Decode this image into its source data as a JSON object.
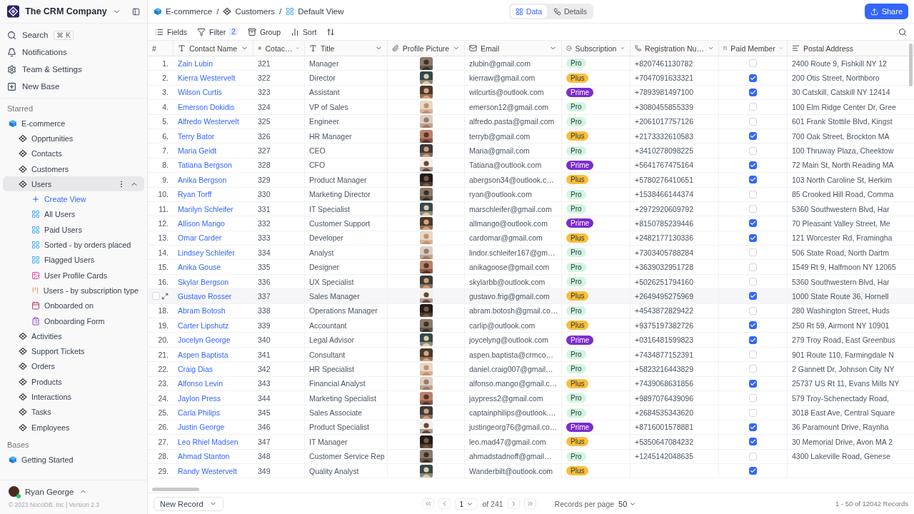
{
  "sidebar": {
    "workspace": "The CRM Company",
    "actions": [
      {
        "label": "Search",
        "kind": "search",
        "shortcut": "⌘ K"
      },
      {
        "label": "Notifications",
        "kind": "bell"
      },
      {
        "label": "Team & Settings",
        "kind": "gear"
      },
      {
        "label": "New Base",
        "kind": "new"
      }
    ],
    "sections": [
      {
        "title": "Starred",
        "bases": [
          {
            "name": "E-commerce",
            "tables": [
              {
                "name": "Opprtunities",
                "selected": false,
                "expanded": false
              },
              {
                "name": "Contacts",
                "selected": false,
                "expanded": false
              },
              {
                "name": "Customers",
                "selected": false,
                "expanded": false
              },
              {
                "name": "Users",
                "selected": true,
                "expanded": true,
                "views": [
                  {
                    "label": "Create View",
                    "kind": "create"
                  },
                  {
                    "label": "All Users",
                    "kind": "grid"
                  },
                  {
                    "label": "Paid Users",
                    "kind": "grid"
                  },
                  {
                    "label": "Sorted - by orders placed",
                    "kind": "grid"
                  },
                  {
                    "label": "Flagged Users",
                    "kind": "grid"
                  },
                  {
                    "label": "User Profile Cards",
                    "kind": "gallery"
                  },
                  {
                    "label": "Users - by subscription type",
                    "kind": "kanban"
                  },
                  {
                    "label": "Onboarded on",
                    "kind": "calendar"
                  },
                  {
                    "label": "Onboarding Form",
                    "kind": "form"
                  }
                ]
              },
              {
                "name": "Activities",
                "selected": false,
                "expanded": false
              },
              {
                "name": "Support Tickets",
                "selected": false,
                "expanded": false
              },
              {
                "name": "Orders",
                "selected": false,
                "expanded": false
              },
              {
                "name": "Products",
                "selected": false,
                "expanded": false
              },
              {
                "name": "Interactions",
                "selected": false,
                "expanded": false
              },
              {
                "name": "Tasks",
                "selected": false,
                "expanded": false
              },
              {
                "name": "Employees",
                "selected": false,
                "expanded": false
              }
            ]
          }
        ]
      },
      {
        "title": "Bases",
        "bases": [
          {
            "name": "Getting Started"
          }
        ]
      }
    ],
    "user": {
      "name": "Ryan George",
      "online": true
    },
    "copyright": "© 2023 NocoDB. Inc | Version 2.3"
  },
  "topbar": {
    "separator": "/",
    "breadcrumb": [
      {
        "label": "E-commerce",
        "kind": "base"
      },
      {
        "label": "Customers",
        "kind": "table"
      },
      {
        "label": "Default View",
        "kind": "grid"
      }
    ],
    "tabs": [
      {
        "label": "Data",
        "kind": "data",
        "selected": true
      },
      {
        "label": "Details",
        "kind": "details",
        "selected": false
      }
    ],
    "share": "Share"
  },
  "toolbar": {
    "items": [
      {
        "label": "Fields",
        "kind": "fields"
      },
      {
        "label": "Filter",
        "kind": "filter",
        "count": "2"
      },
      {
        "label": "Group",
        "kind": "group"
      },
      {
        "label": "Sort",
        "kind": "sort"
      },
      {
        "kind": "row-height"
      }
    ]
  },
  "table": {
    "columns": [
      {
        "label": "#",
        "kind": "index"
      },
      {
        "label": "Contact Name",
        "kind": "text"
      },
      {
        "label": "Cotac…",
        "kind": "number"
      },
      {
        "label": "Title",
        "kind": "text"
      },
      {
        "label": "Profile Picture",
        "kind": "attachment"
      },
      {
        "label": "Email",
        "kind": "email"
      },
      {
        "label": "Subscription",
        "kind": "select"
      },
      {
        "label": "Registration Nu…",
        "kind": "phone"
      },
      {
        "label": "Paid Member",
        "kind": "checkbox"
      },
      {
        "label": "Postal Address",
        "kind": "address"
      }
    ],
    "rows": [
      {
        "n": "1.",
        "name": "Zain Lubin",
        "id": "321",
        "title": "Manager",
        "email": "zlubin@gmail.com",
        "sub": {
          "label": "Pro",
          "color": "#d2f4e3"
        },
        "phone": "+8207461130782",
        "paid": false,
        "address": "2400 Route 9, Fishkill NY 12",
        "hovered": false
      },
      {
        "n": "2.",
        "name": "Kierra Westervelt",
        "id": "322",
        "title": "Director",
        "email": "kierraw@gmail.com",
        "sub": {
          "label": "Plus",
          "color": "#fbbd3c"
        },
        "phone": "+7047091633321",
        "paid": true,
        "address": "200 Otis Street, Northboro",
        "hovered": false
      },
      {
        "n": "3.",
        "name": "Wilson Curtis",
        "id": "323",
        "title": "Assistant",
        "email": "wilcurtis@outlook.com",
        "sub": {
          "label": "Prime",
          "color": "#7b2bd1"
        },
        "phone": "+7893981497100",
        "paid": true,
        "address": "30 Catskill, Catskill NY 12414",
        "hovered": false
      },
      {
        "n": "4.",
        "name": "Emerson Dokidis",
        "id": "324",
        "title": "VP of Sales",
        "email": "emerson12@gmail.com",
        "sub": {
          "label": "Pro",
          "color": "#d2f4e3"
        },
        "phone": "+3080455855339",
        "paid": false,
        "address": "100 Elm Ridge Center Dr, Gree",
        "hovered": false
      },
      {
        "n": "5.",
        "name": "Alfredo Westervelt",
        "id": "325",
        "title": "Engineer",
        "email": "alfredo.pasta@gmail.com",
        "sub": {
          "label": "Pro",
          "color": "#d2f4e3"
        },
        "phone": "+2061017757126",
        "paid": false,
        "address": "601 Frank Stottile Blvd, Kingst",
        "hovered": false
      },
      {
        "n": "6.",
        "name": "Terry Bator",
        "id": "326",
        "title": "HR Manager",
        "email": "terryb@gmail.com",
        "sub": {
          "label": "Plus",
          "color": "#fbbd3c"
        },
        "phone": "+2173332610583",
        "paid": true,
        "address": "700 Oak Street, Brockton MA",
        "hovered": false
      },
      {
        "n": "7.",
        "name": "Maria Geidt",
        "id": "327",
        "title": "CEO",
        "email": "Maria@gmail.com",
        "sub": {
          "label": "Pro",
          "color": "#d2f4e3"
        },
        "phone": "+3410278098225",
        "paid": false,
        "address": "100 Thruway Plaza, Cheektow",
        "hovered": false
      },
      {
        "n": "8.",
        "name": "Tatiana Bergson",
        "id": "328",
        "title": "CFO",
        "email": "Tatiana@outlook.com",
        "sub": {
          "label": "Prime",
          "color": "#7b2bd1"
        },
        "phone": "+5641767475164",
        "paid": true,
        "address": "72 Main St, North Reading MA",
        "hovered": false
      },
      {
        "n": "9.",
        "name": "Anika Bergson",
        "id": "329",
        "title": "Product Manager",
        "email": "abergson34@outlook.c…",
        "sub": {
          "label": "Plus",
          "color": "#fbbd3c"
        },
        "phone": "+5780276410651",
        "paid": true,
        "address": "103 North Caroline St, Herkim",
        "hovered": false
      },
      {
        "n": "10.",
        "name": "Ryan Torff",
        "id": "330",
        "title": "Marketing Director",
        "email": "ryan@outlook.com",
        "sub": {
          "label": "Pro",
          "color": "#d2f4e3"
        },
        "phone": "+1538466144374",
        "paid": false,
        "address": "85 Crooked Hill Road, Comma",
        "hovered": false
      },
      {
        "n": "11.",
        "name": "Marilyn Schleifer",
        "id": "331",
        "title": "IT Specialist",
        "email": "marschleifer@gmail.com",
        "sub": {
          "label": "Pro",
          "color": "#d2f4e3"
        },
        "phone": "+2972920609792",
        "paid": false,
        "address": "5360 Southwestern Blvd, Har",
        "hovered": false
      },
      {
        "n": "12.",
        "name": "Allison Mango",
        "id": "332",
        "title": "Customer Support",
        "email": "allmango@outlook.com",
        "sub": {
          "label": "Prime",
          "color": "#7b2bd1"
        },
        "phone": "+8150785239446",
        "paid": true,
        "address": "70 Pleasant Valley Street, Me",
        "hovered": false
      },
      {
        "n": "13.",
        "name": "Omar Carder",
        "id": "333",
        "title": "Developer",
        "email": "cardomar@gmail.com",
        "sub": {
          "label": "Plus",
          "color": "#fbbd3c"
        },
        "phone": "+2482177130336",
        "paid": true,
        "address": "121 Worcester Rd, Framingha",
        "hovered": false
      },
      {
        "n": "14.",
        "name": "Lindsey Schleifer",
        "id": "334",
        "title": "Analyst",
        "email": "lindor.schleifer167@gm…",
        "sub": {
          "label": "Pro",
          "color": "#d2f4e3"
        },
        "phone": "+7303405788284",
        "paid": false,
        "address": "506 State Road, North Dartm",
        "hovered": false
      },
      {
        "n": "15.",
        "name": "Anika Gouse",
        "id": "335",
        "title": "Designer",
        "email": "anikagoose@gmail.com",
        "sub": {
          "label": "Pro",
          "color": "#d2f4e3"
        },
        "phone": "+3639032951728",
        "paid": false,
        "address": "1549 Rt 9, Halfmoon NY 12065",
        "hovered": false
      },
      {
        "n": "16.",
        "name": "Skylar Bergson",
        "id": "336",
        "title": "UX Specialist",
        "email": "skylarbb@outlook.com",
        "sub": {
          "label": "Pro",
          "color": "#d2f4e3"
        },
        "phone": "+5026251794160",
        "paid": false,
        "address": "5360 Southwestern Blvd, Har",
        "hovered": false
      },
      {
        "name": "Gustavo Rosser",
        "id": "337",
        "title": "Sales Manager",
        "email": "gustavo.frig@gmail.com",
        "sub": {
          "label": "Plus",
          "color": "#fbbd3c"
        },
        "phone": "+2649495275969",
        "paid": true,
        "address": "1000 State Route 36, Hornell",
        "hovered": true
      },
      {
        "n": "18.",
        "name": "Abram Botosh",
        "id": "338",
        "title": "Operations Manager",
        "email": "abram.botosh@gmail.co…",
        "sub": {
          "label": "Pro",
          "color": "#d2f4e3"
        },
        "phone": "+4543872829422",
        "paid": false,
        "address": "280 Washington Street, Huds",
        "hovered": false
      },
      {
        "n": "19.",
        "name": "Carter Lipshutz",
        "id": "339",
        "title": "Accountant",
        "email": "carlip@outlook.com",
        "sub": {
          "label": "Plus",
          "color": "#fbbd3c"
        },
        "phone": "+9375197382726",
        "paid": true,
        "address": "250 Rt 59, Airmont NY 10901",
        "hovered": false
      },
      {
        "n": "20.",
        "name": "Jocelyn George",
        "id": "340",
        "title": "Legal Advisor",
        "email": "joycelyng@outlook.com",
        "sub": {
          "label": "Prime",
          "color": "#7b2bd1"
        },
        "phone": "+0316481599823",
        "paid": true,
        "address": "279 Troy Road, East Greenbus",
        "hovered": false
      },
      {
        "n": "21.",
        "name": "Aspen Baptista",
        "id": "341",
        "title": "Consultant",
        "email": "aspen.baptista@crmco…",
        "sub": {
          "label": "Pro",
          "color": "#d2f4e3"
        },
        "phone": "+7434877152391",
        "paid": false,
        "address": "901 Route 110, Farmingdale N",
        "hovered": false
      },
      {
        "n": "22.",
        "name": "Craig Dias",
        "id": "342",
        "title": "HR Specialist",
        "email": "daniel.craig007@gmail…",
        "sub": {
          "label": "Pro",
          "color": "#d2f4e3"
        },
        "phone": "+5823216443829",
        "paid": false,
        "address": "2 Gannett Dr, Johnson City NY",
        "hovered": false
      },
      {
        "n": "23.",
        "name": "Alfonso Levin",
        "id": "343",
        "title": "Financial Analyst",
        "email": "alfonso.mango@gmail.c…",
        "sub": {
          "label": "Plus",
          "color": "#fbbd3c"
        },
        "phone": "+7439068631856",
        "paid": true,
        "address": "25737 US Rt 11, Evans Mills NY",
        "hovered": false
      },
      {
        "n": "24.",
        "name": "Jaylon Press",
        "id": "344",
        "title": "Marketing Specialist",
        "email": "jaypress2@gmail.com",
        "sub": {
          "label": "Pro",
          "color": "#d2f4e3"
        },
        "phone": "+9897076439096",
        "paid": false,
        "address": "579 Troy-Schenectady Road,",
        "hovered": false
      },
      {
        "n": "25.",
        "name": "Carla Philips",
        "id": "345",
        "title": "Sales Associate",
        "email": "captainphilips@outlook.…",
        "sub": {
          "label": "Pro",
          "color": "#d2f4e3"
        },
        "phone": "+2684535343620",
        "paid": false,
        "address": "3018 East Ave, Central Square",
        "hovered": false
      },
      {
        "n": "26.",
        "name": "Justin George",
        "id": "346",
        "title": "Product Specialist",
        "email": "justingeorg76@gmail.co…",
        "sub": {
          "label": "Prime",
          "color": "#7b2bd1"
        },
        "phone": "+8716001578881",
        "paid": true,
        "address": "36 Paramount Drive, Raynha",
        "hovered": false
      },
      {
        "n": "27.",
        "name": "Leo Rhiel Madsen",
        "id": "347",
        "title": "IT Manager",
        "email": "leo.mad47@gmail.com",
        "sub": {
          "label": "Plus",
          "color": "#fbbd3c"
        },
        "phone": "+5350647084232",
        "paid": true,
        "address": "30 Memorial Drive, Avon MA 2",
        "hovered": false
      },
      {
        "n": "28.",
        "name": "Ahmad Stanton",
        "id": "348",
        "title": "Customer Service Rep",
        "email": "ahmadstadnoff@gmail…",
        "sub": {
          "label": "Pro",
          "color": "#d2f4e3"
        },
        "phone": "+1245142048635",
        "paid": false,
        "address": "4300 Lakeville Road, Genese",
        "hovered": false
      },
      {
        "n": "29.",
        "name": "Randy Westervelt",
        "id": "349",
        "title": "Quality Analyst",
        "email": "Wanderbilt@outlook.com",
        "sub": {
          "label": "Plus",
          "color": "#fbbd3c"
        },
        "paid": true,
        "hovered": false
      }
    ]
  },
  "footer": {
    "new_record": "New Record",
    "page": "1",
    "of_pages": "of 241",
    "per_page_label": "Records per page",
    "per_page": "50",
    "summary": "1 - 50 of 12042 Records"
  }
}
